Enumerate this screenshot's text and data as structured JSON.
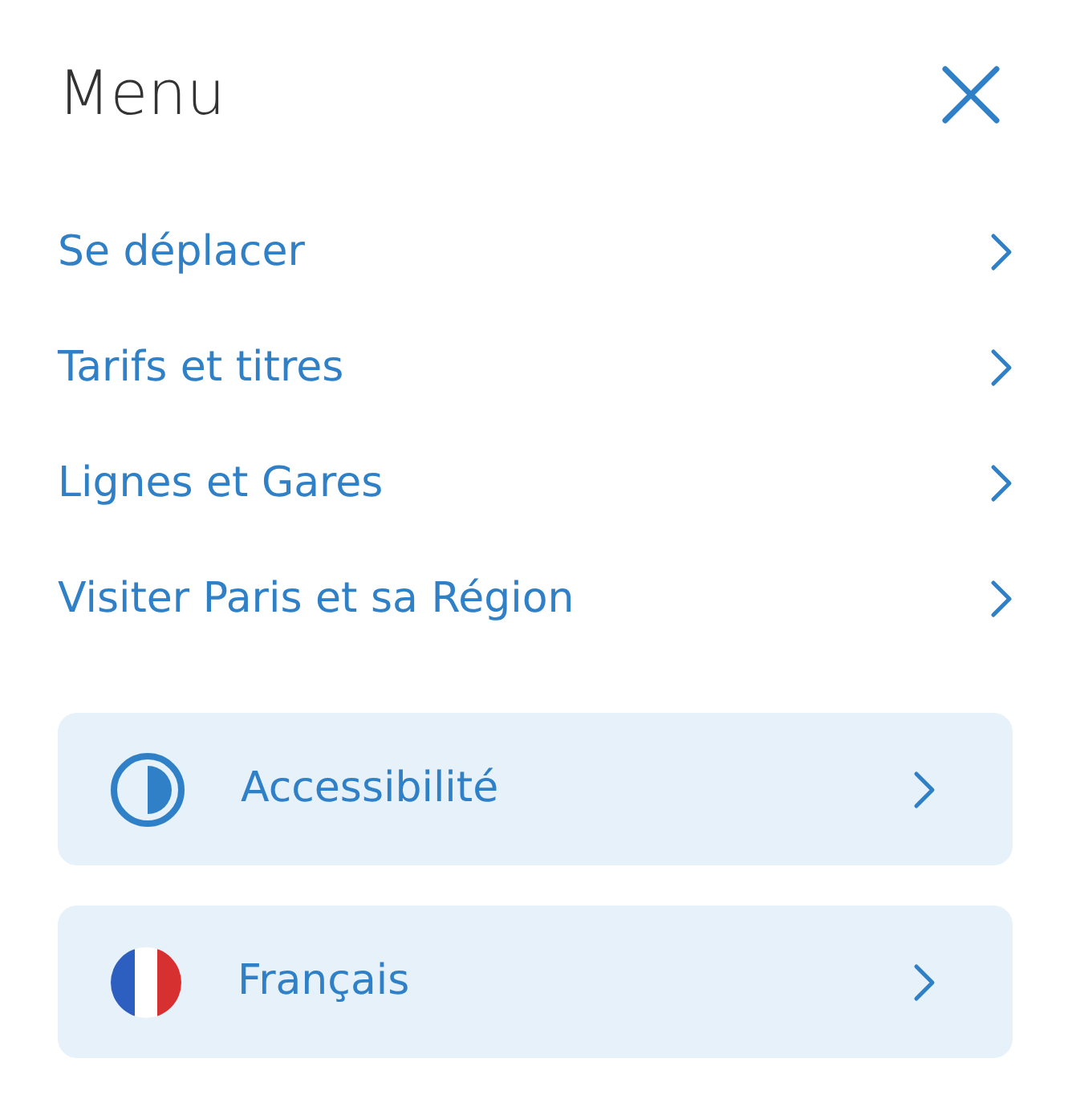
{
  "header": {
    "title": "Menu"
  },
  "menu_items": [
    {
      "label": "Se déplacer"
    },
    {
      "label": "Tarifs et titres"
    },
    {
      "label": "Lignes et Gares"
    },
    {
      "label": "Visiter Paris et sa Région"
    }
  ],
  "options": [
    {
      "kind": "contrast",
      "label": "Accessibilité"
    },
    {
      "kind": "flag",
      "label": "Français"
    }
  ]
}
